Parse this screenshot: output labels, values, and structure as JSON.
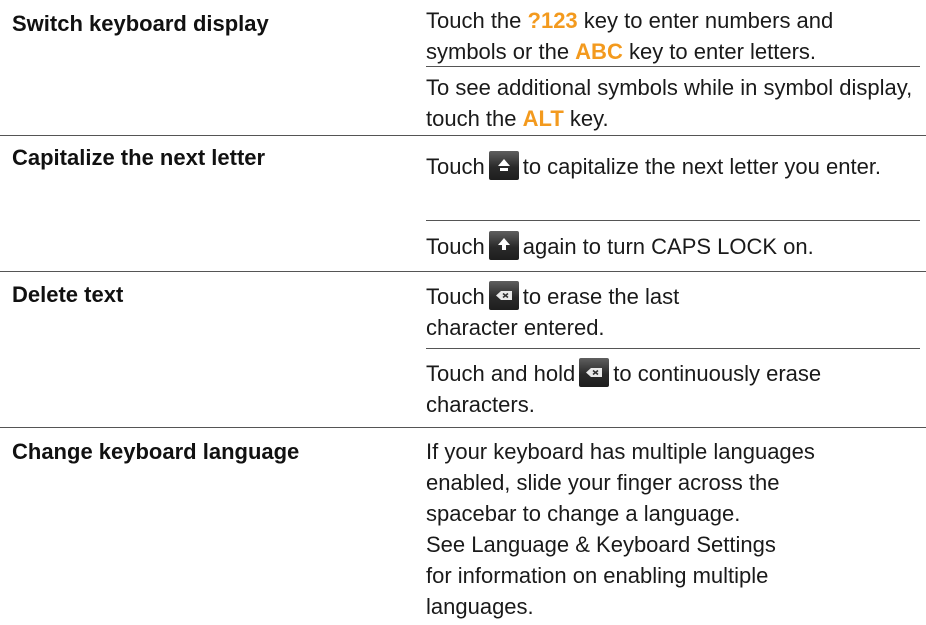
{
  "rows": [
    {
      "task": "Switch keyboard display",
      "p1": {
        "a": "Touch the ",
        "k1": "?123",
        "b": " key to enter numbers and symbols or the ",
        "k2": "ABC",
        "c": " key to enter letters."
      },
      "p2": {
        "a": "To see additional symbols while in symbol display, touch the ",
        "k1": "ALT",
        "b": " key."
      }
    },
    {
      "task": "Capitalize the next letter",
      "p1": {
        "a": "Touch",
        "icon": "shift-key-icon",
        "b": "to capitalize the next letter you enter."
      },
      "p2": {
        "a": "Touch",
        "icon": "shift-key-active-icon",
        "b": "again to turn CAPS LOCK on."
      }
    },
    {
      "task": "Delete text",
      "p1": {
        "a": "Touch",
        "icon": "delete-key-icon",
        "b": "to erase the last",
        "c": "character entered."
      },
      "p2": {
        "a": "Touch and hold",
        "icon": "delete-key-icon",
        "b": "to continuously erase characters."
      }
    },
    {
      "task": "Change keyboard language",
      "p1": {
        "l1": "If your keyboard has multiple languages",
        "l2": "enabled, slide your finger across the",
        "l3": "spacebar to change a language.",
        "l4": "See Language & Keyboard Settings",
        "l5": "for information on enabling multiple",
        "l6": "languages."
      }
    }
  ],
  "colors": {
    "key_highlight": "#f39a1e",
    "rule": "#555555",
    "key_bg": "#2a2a2a"
  }
}
